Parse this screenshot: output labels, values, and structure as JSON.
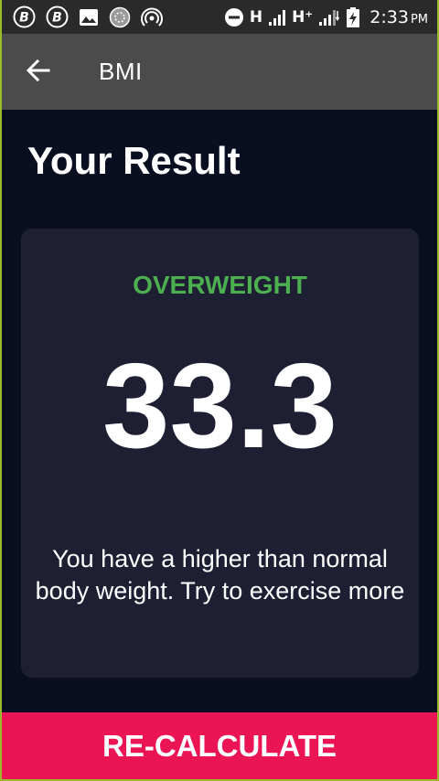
{
  "status_bar": {
    "network_1": "H",
    "network_2": "H⁺",
    "time": "2:33",
    "ampm": "PM",
    "icons": [
      "bitcoin-icon",
      "bitcoin-icon",
      "image-icon",
      "settings-round-icon",
      "hotspot-icon",
      "do-not-disturb-icon",
      "signal-icon",
      "signal-icon",
      "battery-charging-icon"
    ]
  },
  "app_bar": {
    "title": "BMI",
    "back_icon": "arrow-back-icon"
  },
  "page": {
    "title": "Your Result"
  },
  "result": {
    "status": "OVERWEIGHT",
    "status_color": "#4caf50",
    "value": "33.3",
    "interpretation": "You have a higher than normal body weight. Try to exercise more"
  },
  "action": {
    "label": "RE-CALCULATE",
    "color": "#eb1555"
  },
  "colors": {
    "background": "#0a0e21",
    "card": "#1e1f33",
    "app_bar": "#4a4b4a"
  }
}
